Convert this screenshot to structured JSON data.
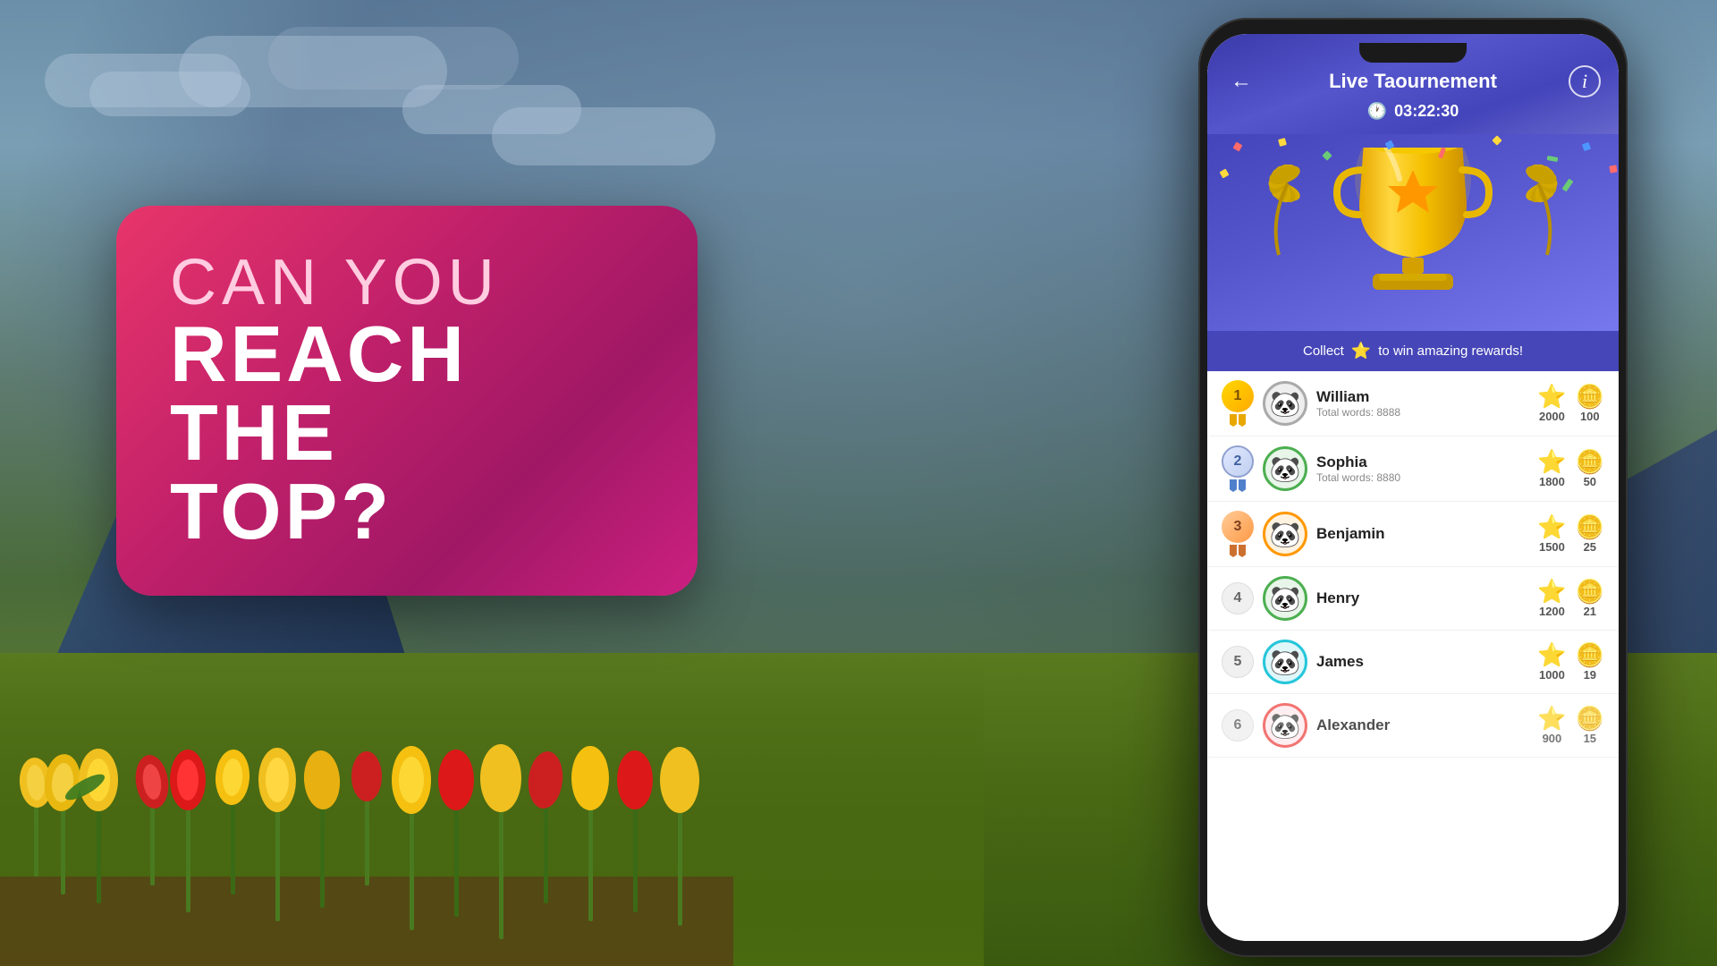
{
  "background": {
    "colors": {
      "sky_top": "#7090aa",
      "sky_bottom": "#8aaa70",
      "field": "#5a7a20"
    }
  },
  "promo": {
    "line1": "CAN YOU",
    "line2": "REACH THE",
    "line3": "TOP?"
  },
  "app": {
    "header": {
      "title": "Live Taournement",
      "timer": "03:22:30",
      "back_label": "←",
      "info_label": "i"
    },
    "collect_bar": {
      "text_before": "Collect",
      "text_after": "to win amazing rewards!",
      "star": "⭐"
    },
    "leaderboard": {
      "players": [
        {
          "rank": 1,
          "name": "William",
          "total_words": "Total words: 8888",
          "score": 2000,
          "coins": 100,
          "avatar": "🐼",
          "avatar_border": "#aaaaaa"
        },
        {
          "rank": 2,
          "name": "Sophia",
          "total_words": "Total words: 8880",
          "score": 1800,
          "coins": 50,
          "avatar": "🐼",
          "avatar_border": "#4caf50"
        },
        {
          "rank": 3,
          "name": "Benjamin",
          "total_words": "",
          "score": 1500,
          "coins": 25,
          "avatar": "🐼",
          "avatar_border": "#ff9800"
        },
        {
          "rank": 4,
          "name": "Henry",
          "total_words": "",
          "score": 1200,
          "coins": 21,
          "avatar": "🐼",
          "avatar_border": "#4caf50"
        },
        {
          "rank": 5,
          "name": "James",
          "total_words": "",
          "score": 1000,
          "coins": 19,
          "avatar": "🐼",
          "avatar_border": "#26c6da"
        },
        {
          "rank": 6,
          "name": "Alexander",
          "total_words": "",
          "score": 900,
          "coins": 15,
          "avatar": "🐼",
          "avatar_border": "#ef5350"
        }
      ]
    }
  }
}
